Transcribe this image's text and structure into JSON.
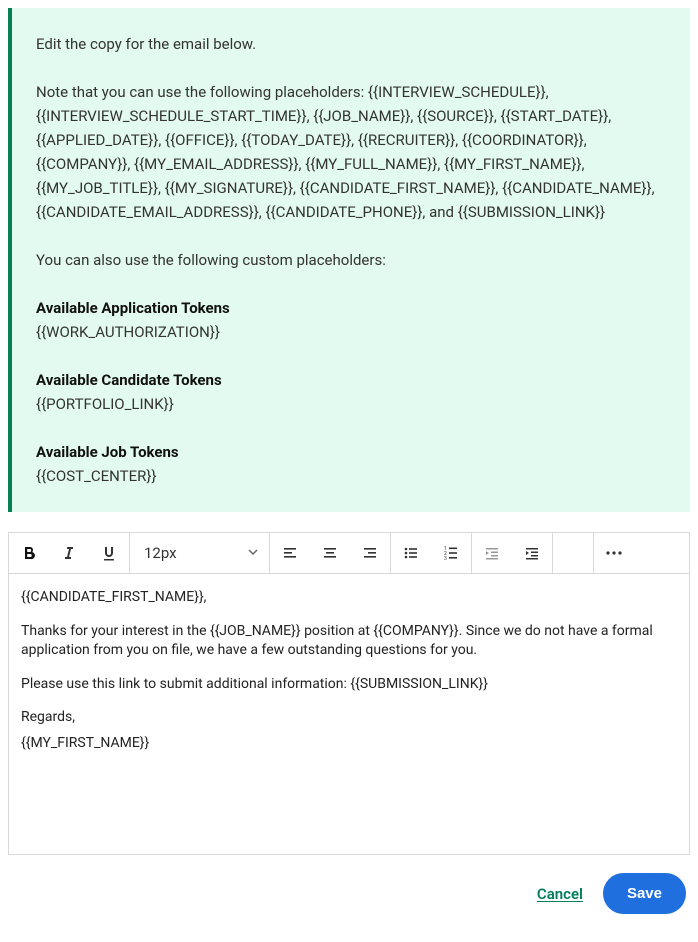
{
  "info": {
    "intro": "Edit the copy for the email below.",
    "placeholder_text": "Note that you can use the following placeholders: {{INTERVIEW_SCHEDULE}}, {{INTERVIEW_SCHEDULE_START_TIME}}, {{JOB_NAME}}, {{SOURCE}}, {{START_DATE}}, {{APPLIED_DATE}}, {{OFFICE}}, {{TODAY_DATE}}, {{RECRUITER}}, {{COORDINATOR}}, {{COMPANY}}, {{MY_EMAIL_ADDRESS}}, {{MY_FULL_NAME}}, {{MY_FIRST_NAME}}, {{MY_JOB_TITLE}}, {{MY_SIGNATURE}}, {{CANDIDATE_FIRST_NAME}}, {{CANDIDATE_NAME}}, {{CANDIDATE_EMAIL_ADDRESS}}, {{CANDIDATE_PHONE}}, and {{SUBMISSION_LINK}}",
    "custom_intro": "You can also use the following custom placeholders:",
    "app_tokens_heading": "Available Application Tokens",
    "app_tokens_list": "{{WORK_AUTHORIZATION}}",
    "cand_tokens_heading": "Available Candidate Tokens",
    "cand_tokens_list": "{{PORTFOLIO_LINK}}",
    "job_tokens_heading": "Available Job Tokens",
    "job_tokens_list": "{{COST_CENTER}}"
  },
  "toolbar": {
    "font_size_label": "12px"
  },
  "editor_content": {
    "line1": "{{CANDIDATE_FIRST_NAME}},",
    "line2": "Thanks for your interest in the {{JOB_NAME}} position at {{COMPANY}}. Since we do not have a formal application from you on file, we have a few outstanding questions for you.",
    "line3": "Please use this link to submit additional information: {{SUBMISSION_LINK}}",
    "line4": "Regards,",
    "line5": "{{MY_FIRST_NAME}}"
  },
  "actions": {
    "cancel": "Cancel",
    "save": "Save"
  }
}
